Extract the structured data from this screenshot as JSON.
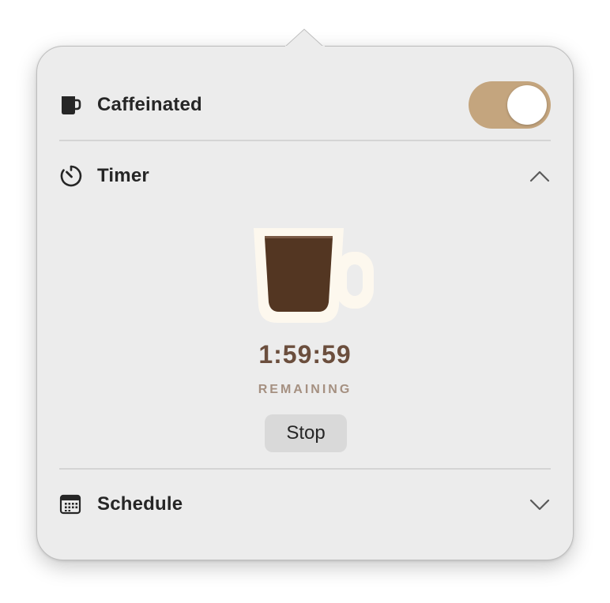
{
  "caffeinated": {
    "label": "Caffeinated",
    "icon": "coffee-mug-icon",
    "toggle_on": true
  },
  "timer": {
    "label": "Timer",
    "icon": "timer-icon",
    "expanded": true,
    "time_remaining": "1:59:59",
    "remaining_label": "REMAINING",
    "stop_label": "Stop",
    "mug_fill_fraction": 0.93
  },
  "schedule": {
    "label": "Schedule",
    "icon": "calendar-icon",
    "expanded": false
  },
  "colors": {
    "accent": "#c4a57e",
    "coffee": "#533622",
    "mug": "#fdf8ee",
    "time_text": "#6b4e3d",
    "remaining_text": "#a59081"
  }
}
